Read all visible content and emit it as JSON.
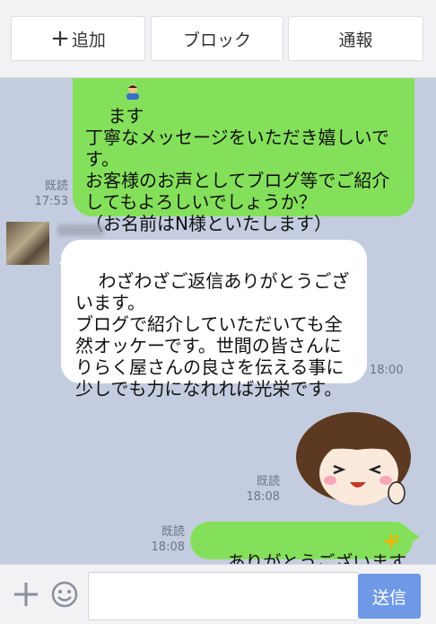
{
  "topbar": {
    "add_label": "追加",
    "block_label": "ブロック",
    "report_label": "通報"
  },
  "messages": [
    {
      "side": "sent",
      "text": "ます\n丁寧なメッセージをいただき嬉しいです。\nお客様のお声としてブログ等でご紹介してもよろしいでしょうか？\n（お名前はN様といたします）",
      "read": "既読",
      "time": "17:53"
    },
    {
      "side": "received",
      "text": "わざわざご返信ありがとうございます。\nブログで紹介していただいても全然オッケーです。世間の皆さんにりらく屋さんの良さを伝える事に少しでも力になれれば光栄です。",
      "time": "18:00"
    },
    {
      "side": "sent",
      "type": "sticker",
      "read": "既読",
      "time": "18:08"
    },
    {
      "side": "sent",
      "text": "ありがとうございます",
      "read": "既読",
      "time": "18:08"
    }
  ],
  "inputbar": {
    "placeholder": "",
    "send_label": "送信"
  },
  "colors": {
    "background": "#c4cde0",
    "sent_bubble": "#84e05a",
    "received_bubble": "#ffffff",
    "send_button": "#6f99e6"
  }
}
